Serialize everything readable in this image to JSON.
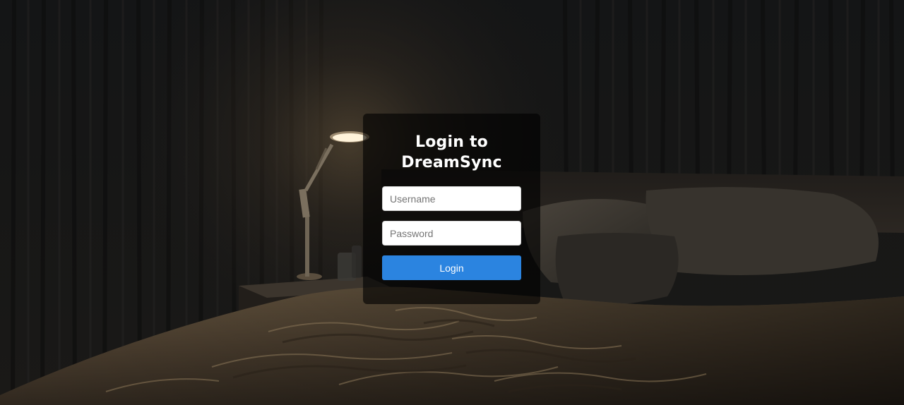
{
  "login": {
    "title": "Login to DreamSync",
    "username_placeholder": "Username",
    "password_placeholder": "Password",
    "submit_label": "Login"
  },
  "colors": {
    "button": "#2b84e0",
    "card_background": "rgba(0,0,0,0.62)",
    "page_background": "#141414"
  }
}
